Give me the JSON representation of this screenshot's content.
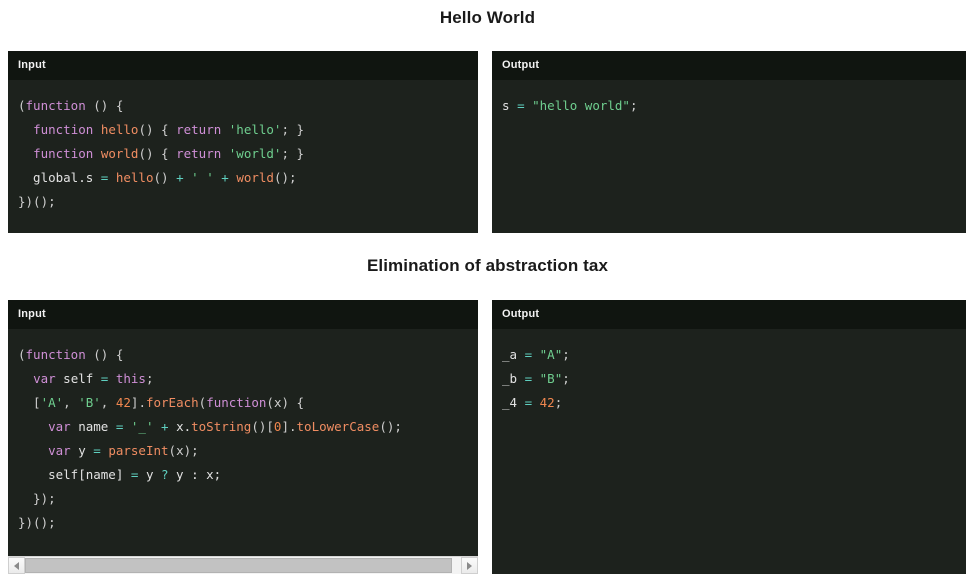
{
  "sections": [
    {
      "title": "Hello World",
      "input": {
        "header": "Input",
        "lines": [
          [
            {
              "t": "(",
              "c": "punc"
            },
            {
              "t": "function",
              "c": "kw"
            },
            {
              "t": " () {",
              "c": "punc"
            }
          ],
          [
            {
              "t": "  ",
              "c": "plain"
            },
            {
              "t": "function",
              "c": "kw"
            },
            {
              "t": " ",
              "c": "plain"
            },
            {
              "t": "hello",
              "c": "fn"
            },
            {
              "t": "() { ",
              "c": "punc"
            },
            {
              "t": "return",
              "c": "kw"
            },
            {
              "t": " ",
              "c": "plain"
            },
            {
              "t": "'hello'",
              "c": "str"
            },
            {
              "t": "; }",
              "c": "punc"
            }
          ],
          [
            {
              "t": "  ",
              "c": "plain"
            },
            {
              "t": "function",
              "c": "kw"
            },
            {
              "t": " ",
              "c": "plain"
            },
            {
              "t": "world",
              "c": "fn"
            },
            {
              "t": "() { ",
              "c": "punc"
            },
            {
              "t": "return",
              "c": "kw"
            },
            {
              "t": " ",
              "c": "plain"
            },
            {
              "t": "'world'",
              "c": "str"
            },
            {
              "t": "; }",
              "c": "punc"
            }
          ],
          [
            {
              "t": "  global.s ",
              "c": "ident"
            },
            {
              "t": "=",
              "c": "op"
            },
            {
              "t": " ",
              "c": "plain"
            },
            {
              "t": "hello",
              "c": "fn"
            },
            {
              "t": "() ",
              "c": "punc"
            },
            {
              "t": "+",
              "c": "op"
            },
            {
              "t": " ",
              "c": "plain"
            },
            {
              "t": "' '",
              "c": "str"
            },
            {
              "t": " ",
              "c": "plain"
            },
            {
              "t": "+",
              "c": "op"
            },
            {
              "t": " ",
              "c": "plain"
            },
            {
              "t": "world",
              "c": "fn"
            },
            {
              "t": "();",
              "c": "punc"
            }
          ],
          [
            {
              "t": "})();",
              "c": "punc"
            }
          ]
        ]
      },
      "output": {
        "header": "Output",
        "lines": [
          [
            {
              "t": "s ",
              "c": "ident"
            },
            {
              "t": "=",
              "c": "op"
            },
            {
              "t": " ",
              "c": "plain"
            },
            {
              "t": "\"hello world\"",
              "c": "str"
            },
            {
              "t": ";",
              "c": "punc"
            }
          ]
        ]
      },
      "scrollbar": false
    },
    {
      "title": "Elimination of abstraction tax",
      "input": {
        "header": "Input",
        "lines": [
          [
            {
              "t": "(",
              "c": "punc"
            },
            {
              "t": "function",
              "c": "kw"
            },
            {
              "t": " () {",
              "c": "punc"
            }
          ],
          [
            {
              "t": "  ",
              "c": "plain"
            },
            {
              "t": "var",
              "c": "kw"
            },
            {
              "t": " self ",
              "c": "ident"
            },
            {
              "t": "=",
              "c": "op"
            },
            {
              "t": " ",
              "c": "plain"
            },
            {
              "t": "this",
              "c": "kw"
            },
            {
              "t": ";",
              "c": "punc"
            }
          ],
          [
            {
              "t": "  [",
              "c": "punc"
            },
            {
              "t": "'A'",
              "c": "str"
            },
            {
              "t": ", ",
              "c": "punc"
            },
            {
              "t": "'B'",
              "c": "str"
            },
            {
              "t": ", ",
              "c": "punc"
            },
            {
              "t": "42",
              "c": "num"
            },
            {
              "t": "].",
              "c": "punc"
            },
            {
              "t": "forEach",
              "c": "fn"
            },
            {
              "t": "(",
              "c": "punc"
            },
            {
              "t": "function",
              "c": "kw"
            },
            {
              "t": "(x) {",
              "c": "punc"
            }
          ],
          [
            {
              "t": "    ",
              "c": "plain"
            },
            {
              "t": "var",
              "c": "kw"
            },
            {
              "t": " name ",
              "c": "ident"
            },
            {
              "t": "=",
              "c": "op"
            },
            {
              "t": " ",
              "c": "plain"
            },
            {
              "t": "'_'",
              "c": "str"
            },
            {
              "t": " ",
              "c": "plain"
            },
            {
              "t": "+",
              "c": "op"
            },
            {
              "t": " x.",
              "c": "ident"
            },
            {
              "t": "toString",
              "c": "fn"
            },
            {
              "t": "()[",
              "c": "punc"
            },
            {
              "t": "0",
              "c": "num"
            },
            {
              "t": "].",
              "c": "punc"
            },
            {
              "t": "toLowerCase",
              "c": "fn"
            },
            {
              "t": "();",
              "c": "punc"
            }
          ],
          [
            {
              "t": "    ",
              "c": "plain"
            },
            {
              "t": "var",
              "c": "kw"
            },
            {
              "t": " y ",
              "c": "ident"
            },
            {
              "t": "=",
              "c": "op"
            },
            {
              "t": " ",
              "c": "plain"
            },
            {
              "t": "parseInt",
              "c": "fn"
            },
            {
              "t": "(x);",
              "c": "punc"
            }
          ],
          [
            {
              "t": "    self[name] ",
              "c": "ident"
            },
            {
              "t": "=",
              "c": "op"
            },
            {
              "t": " y ",
              "c": "ident"
            },
            {
              "t": "?",
              "c": "op"
            },
            {
              "t": " y : x;",
              "c": "ident"
            }
          ],
          [
            {
              "t": "  });",
              "c": "punc"
            }
          ],
          [
            {
              "t": "})();",
              "c": "punc"
            }
          ]
        ]
      },
      "output": {
        "header": "Output",
        "lines": [
          [
            {
              "t": "_a ",
              "c": "ident"
            },
            {
              "t": "=",
              "c": "op"
            },
            {
              "t": " ",
              "c": "plain"
            },
            {
              "t": "\"A\"",
              "c": "str"
            },
            {
              "t": ";",
              "c": "punc"
            }
          ],
          [
            {
              "t": "_b ",
              "c": "ident"
            },
            {
              "t": "=",
              "c": "op"
            },
            {
              "t": " ",
              "c": "plain"
            },
            {
              "t": "\"B\"",
              "c": "str"
            },
            {
              "t": ";",
              "c": "punc"
            }
          ],
          [
            {
              "t": "_4 ",
              "c": "ident"
            },
            {
              "t": "=",
              "c": "op"
            },
            {
              "t": " ",
              "c": "plain"
            },
            {
              "t": "42",
              "c": "num"
            },
            {
              "t": ";",
              "c": "punc"
            }
          ]
        ]
      },
      "scrollbar": true
    }
  ],
  "colors": {
    "page_bg": "#ffffff",
    "panel_bg": "#1d221d",
    "panel_header_bg": "#101510",
    "keyword": "#cf8fd6",
    "function": "#f08d62",
    "string": "#6fcf8f",
    "number": "#f0874f",
    "operator": "#5fd0c0",
    "text": "#d8d8d8",
    "title": "#1a1a1a"
  },
  "scrollbar": {
    "left_arrow_icon": "triangle-left-icon",
    "right_arrow_icon": "triangle-right-icon"
  }
}
